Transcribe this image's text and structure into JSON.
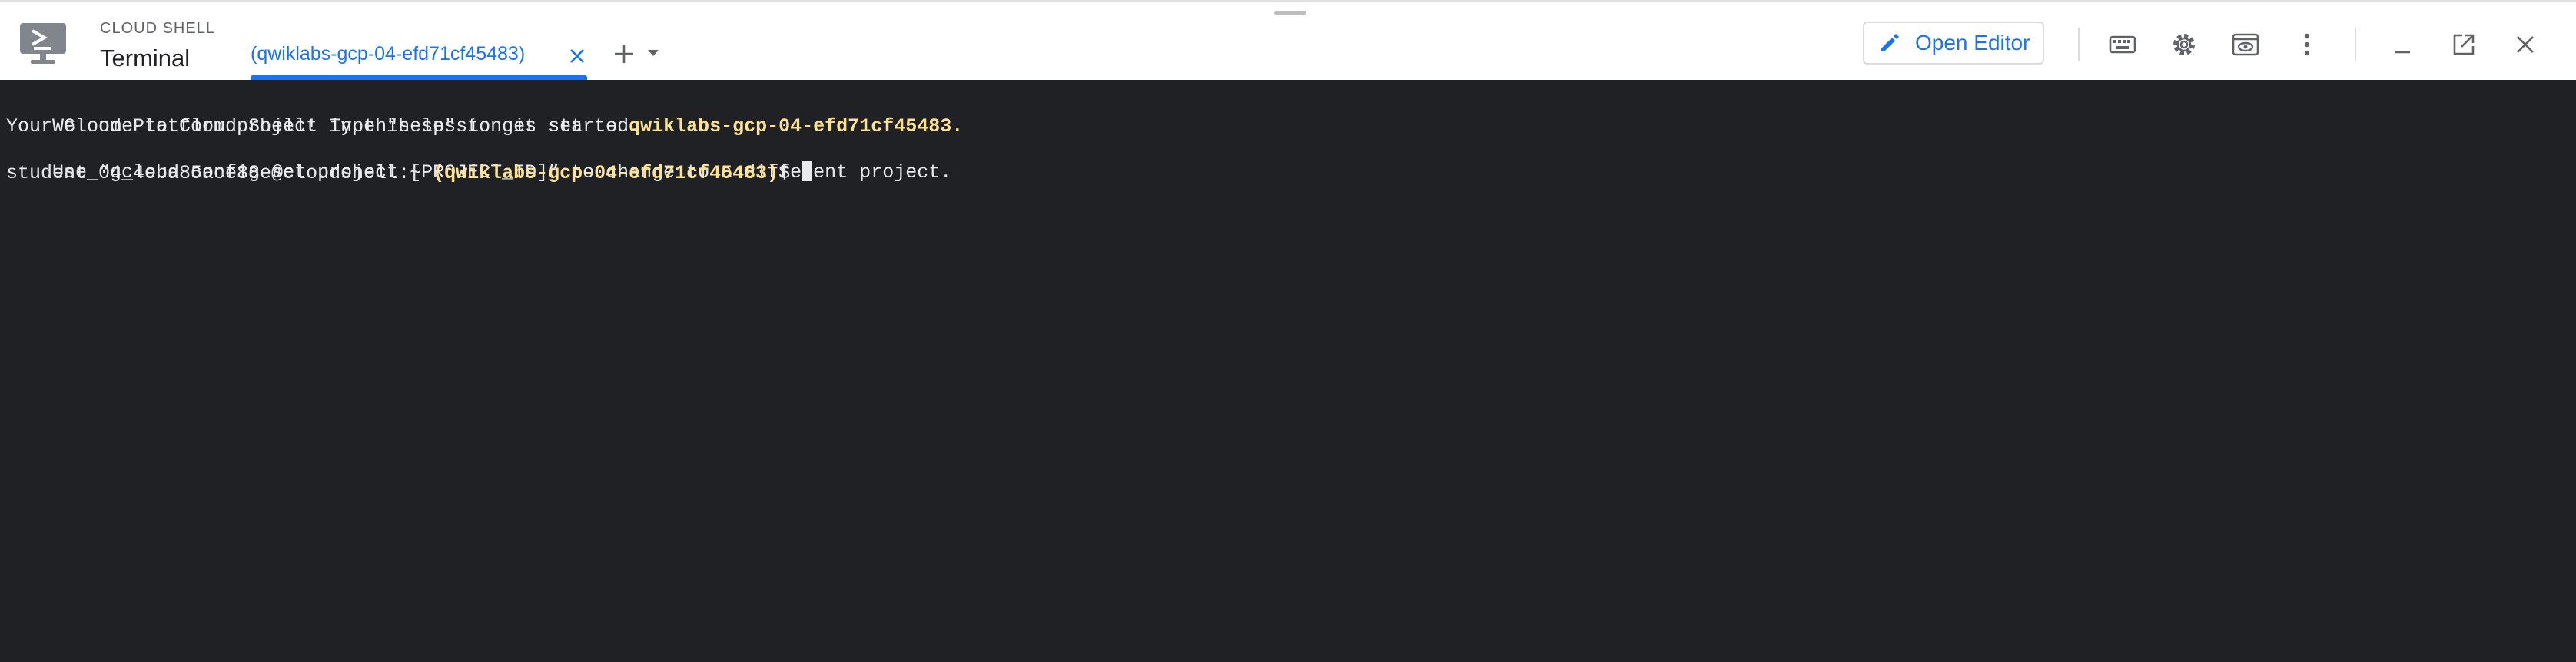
{
  "header": {
    "app_name": "CLOUD SHELL",
    "app_sub": "Terminal",
    "tab": {
      "label": "(qwiklabs-gcp-04-efd71cf45483)"
    },
    "open_editor_label": "Open Editor"
  },
  "icons": {
    "app": "cloud-shell-terminal-icon",
    "tab_close": "close-icon",
    "add_tab": "plus-icon",
    "tab_menu": "chevron-down-icon",
    "open_editor": "pencil-icon",
    "keyboard": "keyboard-icon",
    "settings": "gear-icon",
    "web_preview": "web-preview-icon",
    "more": "more-vert-icon",
    "minimize": "minimize-icon",
    "open_new_window": "open-in-new-icon",
    "close": "close-icon"
  },
  "colors": {
    "accent": "#1a73e8",
    "terminal_bg": "#202124",
    "terminal_fg": "#e8eaed",
    "terminal_highlight": "#fde293"
  },
  "terminal": {
    "line1": "Welcome to Cloud Shell! Type \"help\" to get started.",
    "line2_prefix": "Your Cloud Platform project in this session is set to ",
    "line2_project": "qwiklabs-gcp-04-efd71cf45483",
    "line2_suffix": ".",
    "line3": "Use “gcloud config set project [PROJECT_ID]” to change to a different project.",
    "prompt_user": "student_04_4eba85ace88e@cloudshell:~ ",
    "prompt_project": "(qwiklabs-gcp-04-efd71cf45483)",
    "prompt_symbol": "$ "
  }
}
